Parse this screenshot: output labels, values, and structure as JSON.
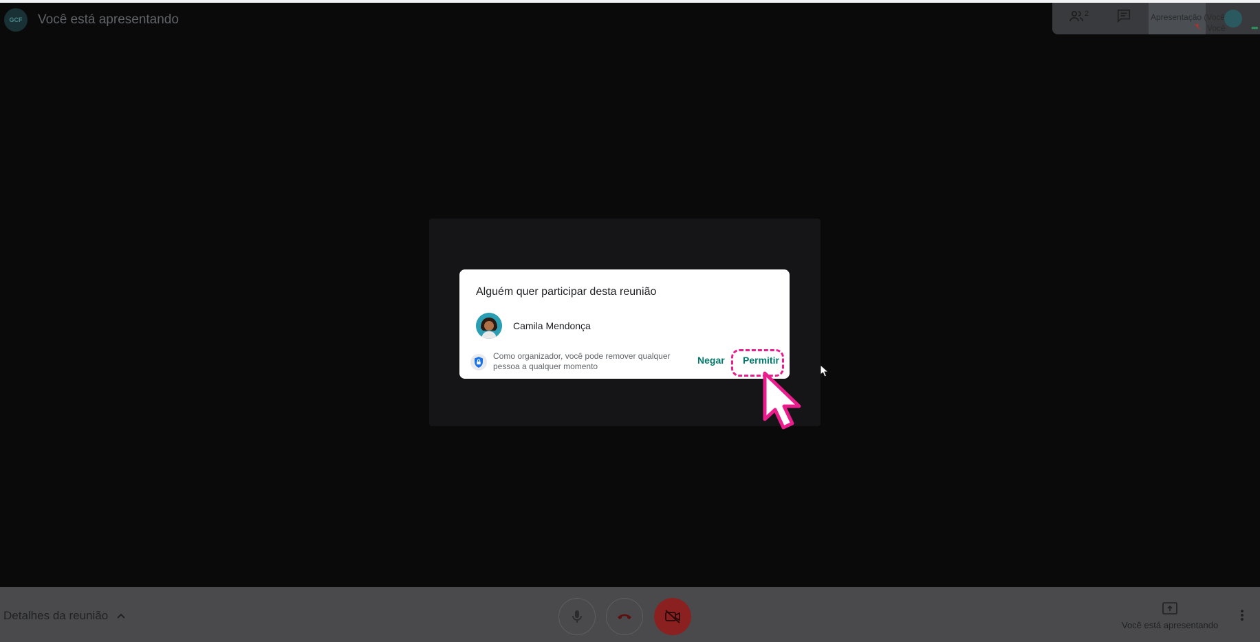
{
  "header": {
    "logo_text": "GCF",
    "presenting_title": "Você está apresentando",
    "participants_count": "2",
    "tile_label": "Apresentação (Você)",
    "self_label": "Você",
    "icons": [
      "people-icon",
      "chat-icon",
      "mic-off-icon"
    ]
  },
  "dialog": {
    "title": "Alguém quer participar desta reunião",
    "guest_name": "Camila Mendonça",
    "info_text": "Como organizador, você pode remover qualquer pessoa a qualquer momento",
    "deny_label": "Negar",
    "allow_label": "Permitir",
    "accent_color": "#00796b",
    "highlight_color": "#e91e8c"
  },
  "bottom": {
    "meeting_details": "Detalhes da reunião",
    "presenting_label": "Você está apresentando",
    "icons": [
      "mic-icon",
      "hangup-icon",
      "camera-off-icon",
      "present-icon",
      "more-vert-icon"
    ]
  }
}
